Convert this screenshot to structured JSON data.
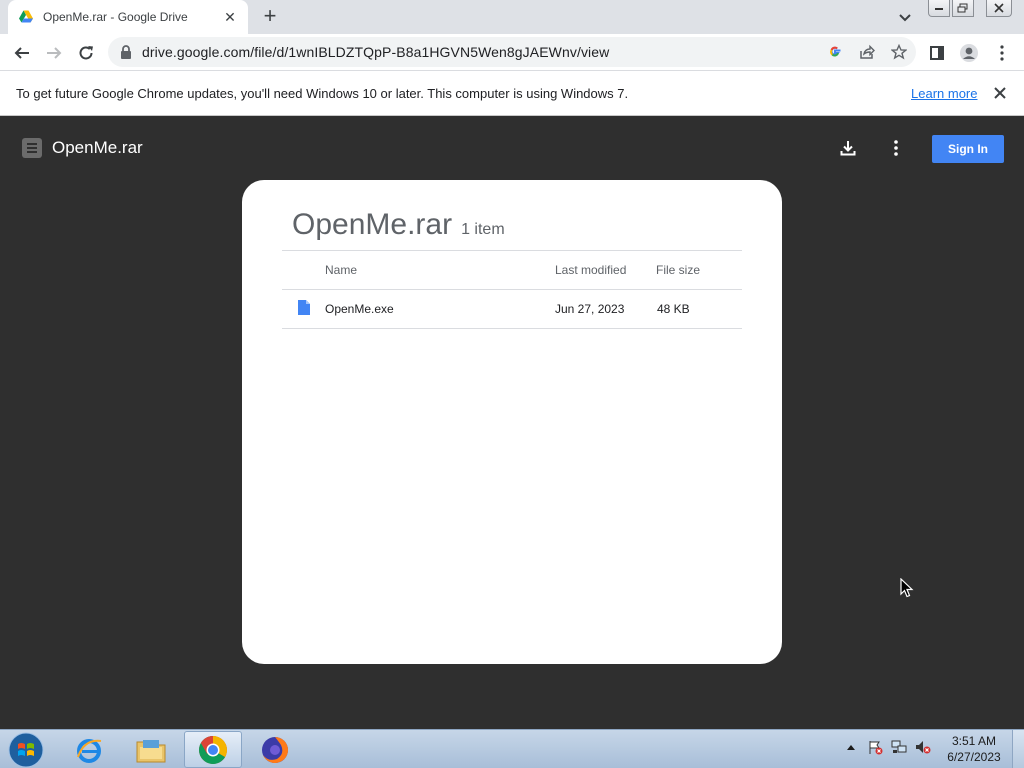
{
  "browser": {
    "tab_title": "OpenMe.rar - Google Drive",
    "tab_close": "✕",
    "new_tab": "+",
    "url": "drive.google.com/file/d/1wnIBLDZTQpP-B8a1HGVN5Wen8gJAEWnv/view"
  },
  "infobar": {
    "message": "To get future Google Chrome updates, you'll need Windows 10 or later. This computer is using Windows 7.",
    "learn_more": "Learn more"
  },
  "viewer": {
    "title": "OpenMe.rar",
    "sign_in": "Sign In"
  },
  "archive": {
    "title": "OpenMe.rar",
    "count": "1 item",
    "columns": {
      "name": "Name",
      "modified": "Last modified",
      "size": "File size"
    },
    "rows": [
      {
        "name": "OpenMe.exe",
        "modified": "Jun 27, 2023",
        "size": "48 KB"
      }
    ]
  },
  "taskbar": {
    "apps": [
      "internet-explorer",
      "file-explorer",
      "chrome",
      "firefox"
    ],
    "time": "3:51 AM",
    "date": "6/27/2023"
  },
  "colors": {
    "accent": "#4285f4",
    "viewer_bg": "#2f2f2f",
    "link": "#1a73e8"
  }
}
